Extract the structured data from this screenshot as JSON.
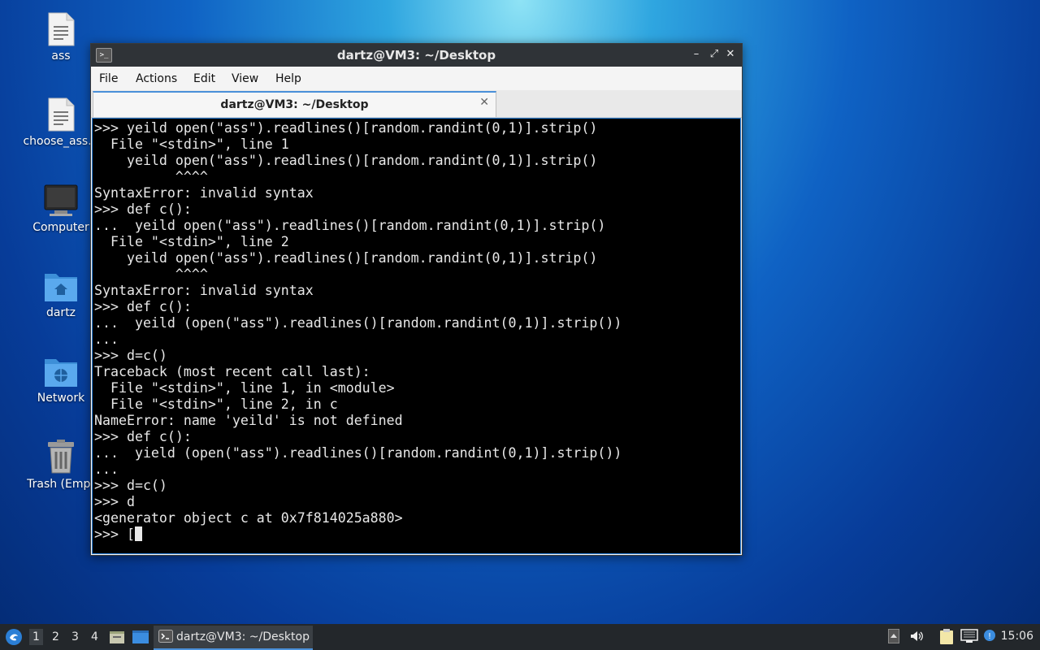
{
  "desktop": {
    "icons": [
      {
        "label": "ass",
        "icon": "text-file-icon"
      },
      {
        "label": "choose_ass.p",
        "icon": "text-file-icon"
      },
      {
        "label": "Computer",
        "icon": "computer-icon"
      },
      {
        "label": "dartz",
        "icon": "home-folder-icon"
      },
      {
        "label": "Network",
        "icon": "network-folder-icon"
      },
      {
        "label": "Trash (Empt",
        "icon": "trash-icon"
      }
    ]
  },
  "window": {
    "title": "dartz@VM3: ~/Desktop",
    "controls": {
      "minimize": "–",
      "maximize": "⤢",
      "close": "✕"
    },
    "menu": [
      "File",
      "Actions",
      "Edit",
      "View",
      "Help"
    ],
    "tab": {
      "label": "dartz@VM3: ~/Desktop",
      "close": "✕"
    },
    "terminal_lines": [
      ">>> yeild open(\"ass\").readlines()[random.randint(0,1)].strip()",
      "  File \"<stdin>\", line 1",
      "    yeild open(\"ass\").readlines()[random.randint(0,1)].strip()",
      "          ^^^^",
      "SyntaxError: invalid syntax",
      ">>> def c():",
      "...  yeild open(\"ass\").readlines()[random.randint(0,1)].strip()",
      "  File \"<stdin>\", line 2",
      "    yeild open(\"ass\").readlines()[random.randint(0,1)].strip()",
      "          ^^^^",
      "SyntaxError: invalid syntax",
      ">>> def c():",
      "...  yeild (open(\"ass\").readlines()[random.randint(0,1)].strip())",
      "...",
      ">>> d=c()",
      "Traceback (most recent call last):",
      "  File \"<stdin>\", line 1, in <module>",
      "  File \"<stdin>\", line 2, in c",
      "NameError: name 'yeild' is not defined",
      ">>> def c():",
      "...  yield (open(\"ass\").readlines()[random.randint(0,1)].strip())",
      "...",
      ">>> d=c()",
      ">>> d",
      "<generator object c at 0x7f814025a880>"
    ],
    "prompt_line": ">>> ["
  },
  "taskbar": {
    "workspaces": [
      "1",
      "2",
      "3",
      "4"
    ],
    "active_workspace": "1",
    "task_label": "dartz@VM3: ~/Desktop",
    "clock": "15:06"
  },
  "colors": {
    "accent": "#4a90d9",
    "terminal_bg": "#000000",
    "titlebar": "#2f3337"
  }
}
